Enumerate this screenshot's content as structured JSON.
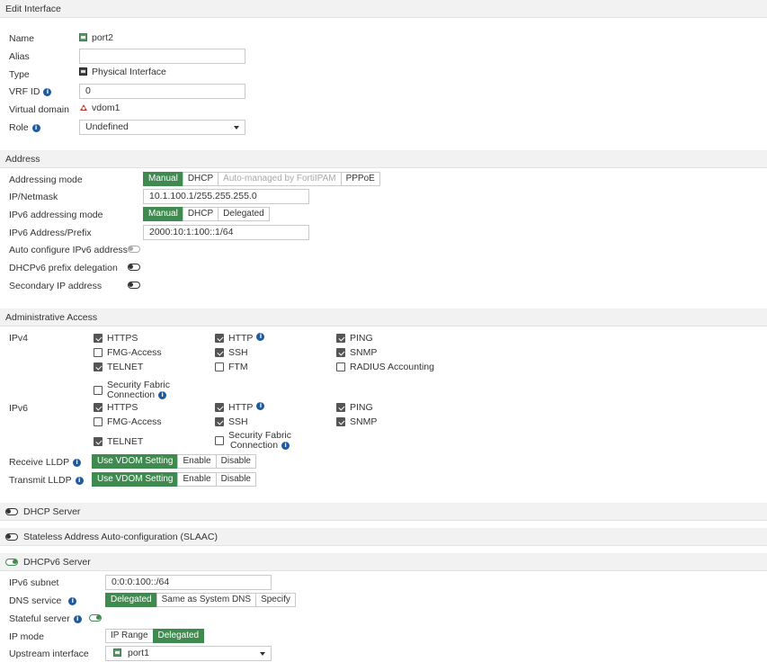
{
  "header": {
    "title": "Edit Interface"
  },
  "general": {
    "name_label": "Name",
    "name_value": "port2",
    "alias_label": "Alias",
    "alias_value": "",
    "type_label": "Type",
    "type_value": "Physical Interface",
    "vrf_label": "VRF ID",
    "vrf_value": "0",
    "vdom_label": "Virtual domain",
    "vdom_value": "vdom1",
    "role_label": "Role",
    "role_value": "Undefined"
  },
  "address": {
    "section": "Address",
    "mode_label": "Addressing mode",
    "mode_options": [
      "Manual",
      "DHCP",
      "Auto-managed by FortiIPAM",
      "PPPoE"
    ],
    "netmask_label": "IP/Netmask",
    "netmask_value": "10.1.100.1/255.255.255.0",
    "ipv6_mode_label": "IPv6 addressing mode",
    "ipv6_mode_options": [
      "Manual",
      "DHCP",
      "Delegated"
    ],
    "ipv6_addr_label": "IPv6 Address/Prefix",
    "ipv6_addr_value": "2000:10:1:100::1/64",
    "auto_conf_label": "Auto configure IPv6 address",
    "dhcpv6_pd_label": "DHCPv6 prefix delegation",
    "secondary_label": "Secondary IP address"
  },
  "admin": {
    "section": "Administrative Access",
    "ipv4_label": "IPv4",
    "ipv6_label": "IPv6",
    "opt_https": "HTTPS",
    "opt_http": "HTTP",
    "opt_ping": "PING",
    "opt_fmg": "FMG-Access",
    "opt_ssh": "SSH",
    "opt_snmp": "SNMP",
    "opt_telnet": "TELNET",
    "opt_ftm": "FTM",
    "opt_radius": "RADIUS Accounting",
    "opt_sf1": "Security Fabric",
    "opt_sf2": "Connection",
    "receive_lldp_label": "Receive LLDP",
    "transmit_lldp_label": "Transmit LLDP",
    "lldp_options": [
      "Use VDOM Setting",
      "Enable",
      "Disable"
    ]
  },
  "dhcp_server": {
    "label": "DHCP Server"
  },
  "slaac": {
    "label": "Stateless Address Auto-configuration (SLAAC)"
  },
  "dhcpv6": {
    "label": "DHCPv6 Server",
    "subnet_label": "IPv6 subnet",
    "subnet_value": "0:0:0:100::/64",
    "dns_label": "DNS service",
    "dns_options": [
      "Delegated",
      "Same as System DNS",
      "Specify"
    ],
    "stateful_label": "Stateful server",
    "ipmode_label": "IP mode",
    "ipmode_options": [
      "IP Range",
      "Delegated"
    ],
    "upstream_label": "Upstream interface",
    "upstream_value": "port1"
  },
  "colors": {
    "accent": "#3f8b4f",
    "info": "#1e5aa0",
    "header_bg": "#f2f2f2"
  }
}
